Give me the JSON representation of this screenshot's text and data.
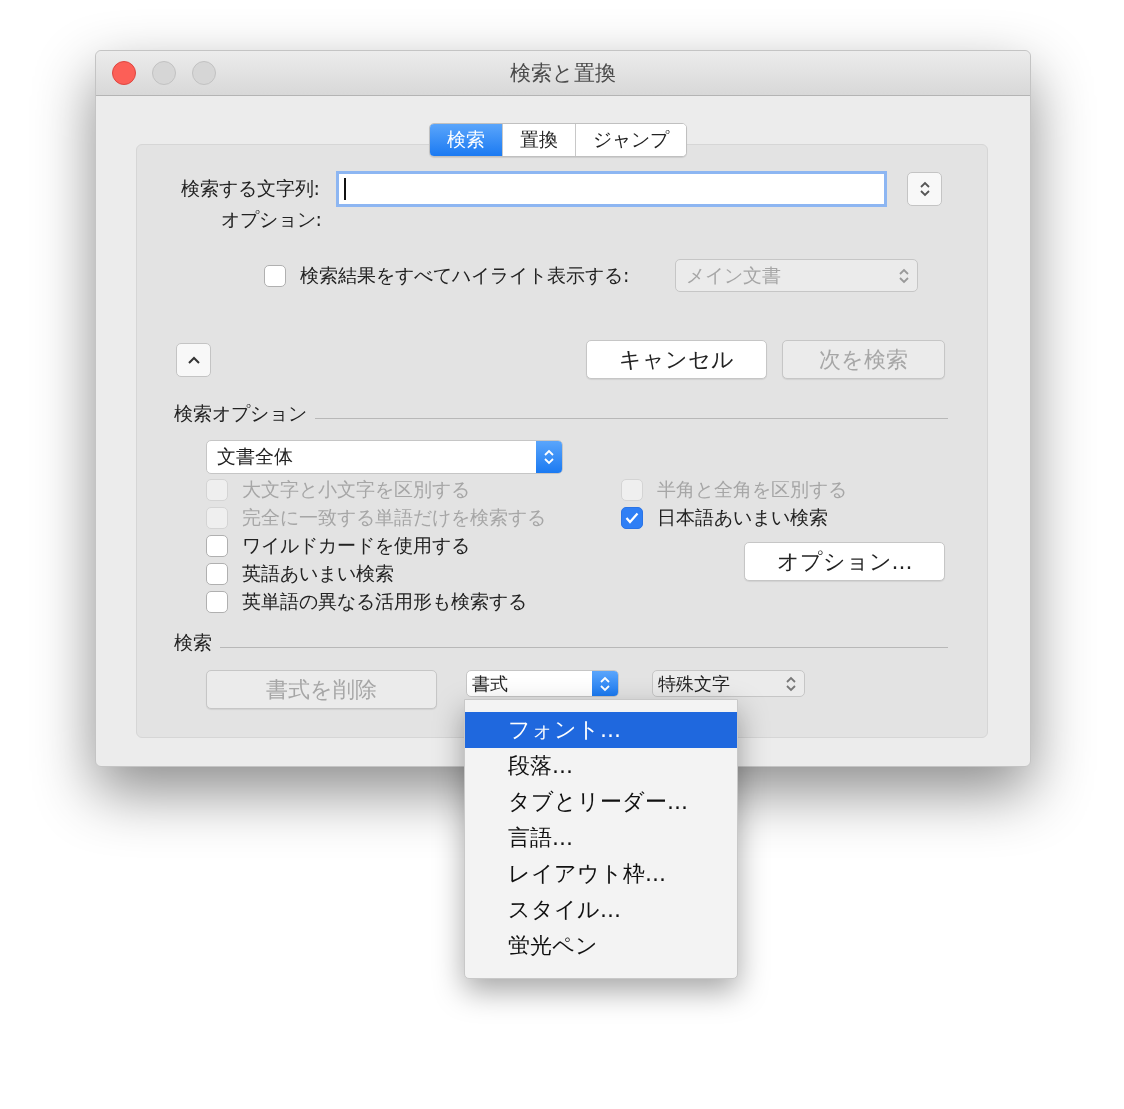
{
  "window": {
    "title": "検索と置換"
  },
  "tabs": [
    {
      "label": "検索",
      "selected": true
    },
    {
      "label": "置換",
      "selected": false
    },
    {
      "label": "ジャンプ",
      "selected": false
    }
  ],
  "search": {
    "label": "検索する文字列:"
  },
  "options_label": "オプション:",
  "highlight": {
    "label": "検索結果をすべてハイライト表示する:",
    "checked": false
  },
  "highlight_scope": {
    "value": "メイン文書",
    "disabled": true
  },
  "buttons": [
    {
      "label": "キャンセル",
      "disabled": false
    },
    {
      "label": "次を検索",
      "disabled": true
    }
  ],
  "search_options": {
    "title": "検索オプション",
    "scope": "文書全体",
    "left_checks": [
      {
        "label": "大文字と小文字を区別する",
        "checked": false,
        "disabled": true
      },
      {
        "label": "完全に一致する単語だけを検索する",
        "checked": false,
        "disabled": true
      },
      {
        "label": "ワイルドカードを使用する",
        "checked": false,
        "disabled": false
      },
      {
        "label": "英語あいまい検索",
        "checked": false,
        "disabled": false
      },
      {
        "label": "英単語の異なる活用形も検索する",
        "checked": false,
        "disabled": false
      }
    ],
    "right_checks": [
      {
        "label": "半角と全角を区別する",
        "checked": false,
        "disabled": true
      },
      {
        "label": "日本語あいまい検索",
        "checked": true,
        "disabled": false
      }
    ],
    "button": "オプション..."
  },
  "find": {
    "title": "検索",
    "clear_button": {
      "label": "書式を削除",
      "disabled": true
    },
    "format": {
      "value": "書式",
      "expanded": true
    },
    "special": {
      "value": "特殊文字"
    }
  },
  "menu": [
    {
      "label": "フォント...",
      "selected": true
    },
    {
      "label": "段落...",
      "selected": false
    },
    {
      "label": "タブとリーダー...",
      "selected": false
    },
    {
      "label": "言語...",
      "selected": false
    },
    {
      "label": "レイアウト枠...",
      "selected": false
    },
    {
      "label": "スタイル...",
      "selected": false
    },
    {
      "label": "蛍光ペン",
      "selected": false
    }
  ]
}
